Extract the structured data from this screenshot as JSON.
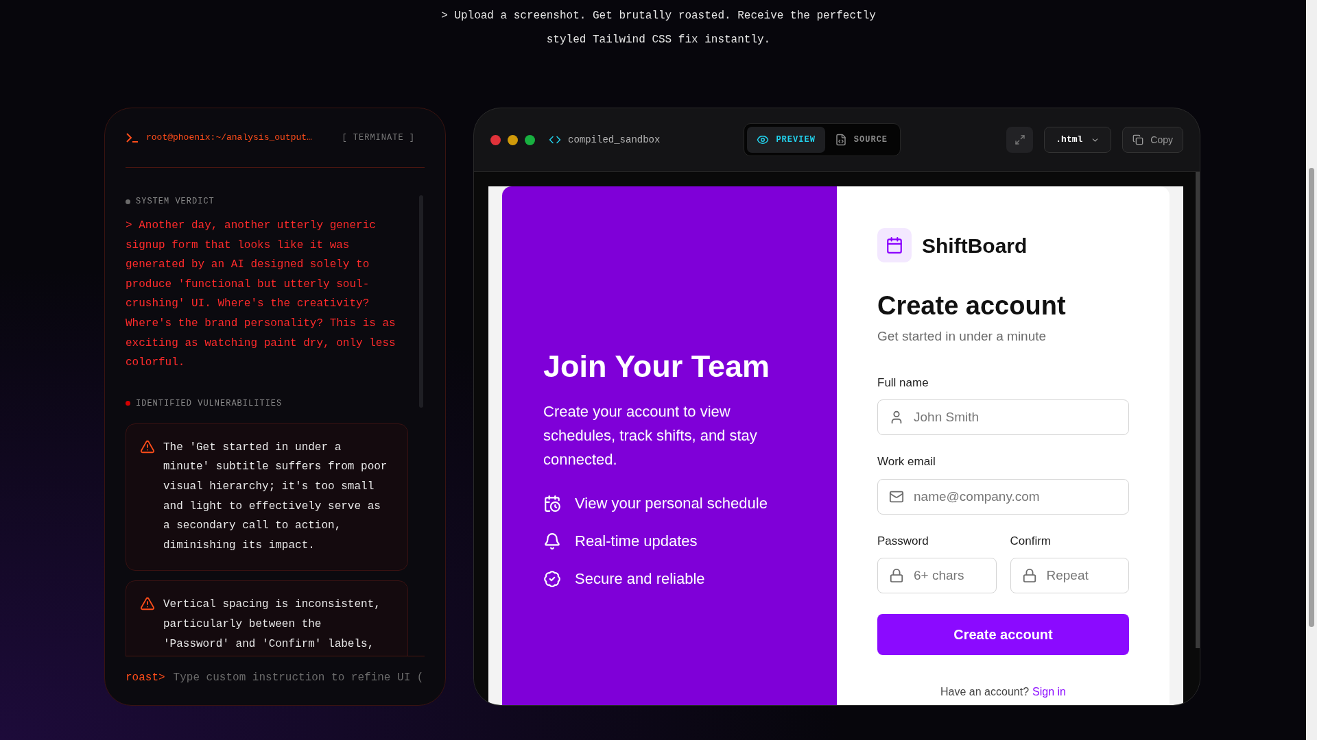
{
  "tagline": "> Upload a screenshot. Get brutally roasted. Receive the perfectly styled Tailwind CSS fix instantly.",
  "terminal": {
    "path": "root@phoenix:~/analysis_output…",
    "terminate": "[ TERMINATE ]",
    "verdict": {
      "label": "SYSTEM VERDICT",
      "color": "#6b6b6b",
      "text": "> Another day, another utterly generic signup form that looks like it was generated by an AI designed solely to produce 'functional but utterly soul-crushing' UI. Where's the creativity? Where's the brand personality? This is as exciting as watching paint dry, only less colorful."
    },
    "vulnerabilities": {
      "label": "IDENTIFIED VULNERABILITIES",
      "color": "#d40000",
      "items": [
        "The 'Get started in under a minute' subtitle suffers from poor visual hierarchy; it's too small and light to effectively serve as a secondary call to action, diminishing its impact.",
        "Vertical spacing is inconsistent, particularly between the 'Password' and 'Confirm' labels,"
      ]
    },
    "prompt": {
      "label": "roast>",
      "placeholder": "Type custom instruction to refine UI ("
    }
  },
  "sandbox": {
    "title": "compiled_sandbox",
    "tabs": [
      {
        "label": "PREVIEW",
        "kind": "eye",
        "selected": true
      },
      {
        "label": "SOURCE",
        "kind": "file",
        "selected": false
      }
    ],
    "format": ".html",
    "copy": "Copy"
  },
  "preview": {
    "hero": {
      "title": "Join Your Team",
      "text": "Create your account to view schedules, track shifts, and stay connected.",
      "features": [
        {
          "kind": "calendar",
          "label": "View your personal schedule"
        },
        {
          "kind": "bell",
          "label": "Real-time updates"
        },
        {
          "kind": "check",
          "label": "Secure and reliable"
        }
      ]
    },
    "form": {
      "brand": "ShiftBoard",
      "title": "Create account",
      "subtitle": "Get started in under a minute",
      "rows": [
        [
          {
            "label": "Full name",
            "placeholder": "John Smith",
            "kind": "person"
          }
        ],
        [
          {
            "label": "Work email",
            "placeholder": "name@company.com",
            "kind": "mail"
          }
        ],
        [
          {
            "label": "Password",
            "placeholder": "6+ chars",
            "kind": "lock"
          },
          {
            "label": "Confirm",
            "placeholder": "Repeat",
            "kind": "lock"
          }
        ]
      ],
      "submit": "Create account",
      "footer": {
        "text": "Have an account?",
        "link": "Sign in"
      }
    }
  }
}
